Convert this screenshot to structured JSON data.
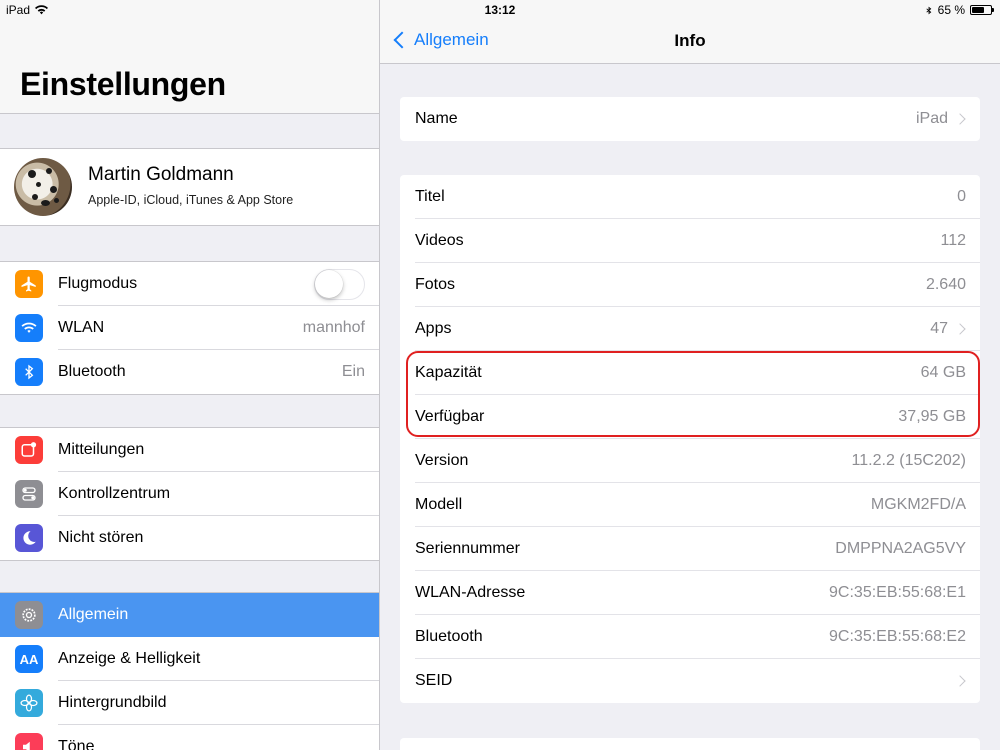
{
  "statusbar": {
    "device": "iPad",
    "time": "13:12",
    "battery": "65 %",
    "battery_level": 0.65
  },
  "left": {
    "title": "Einstellungen",
    "profile": {
      "name": "Martin Goldmann",
      "subtitle": "Apple-ID, iCloud, iTunes & App Store"
    },
    "group1": [
      {
        "label": "Flugmodus",
        "icon": "airplane-icon",
        "color": "#ff9500",
        "toggle": false
      },
      {
        "label": "WLAN",
        "value": "mannhof",
        "icon": "wifi-icon",
        "color": "#157efb"
      },
      {
        "label": "Bluetooth",
        "value": "Ein",
        "icon": "bluetooth-icon",
        "color": "#157efb"
      }
    ],
    "group2": [
      {
        "label": "Mitteilungen",
        "icon": "notifications-icon",
        "color": "#fc3d39"
      },
      {
        "label": "Kontrollzentrum",
        "icon": "control-center-icon",
        "color": "#8e8e93"
      },
      {
        "label": "Nicht stören",
        "icon": "moon-icon",
        "color": "#5856d6"
      }
    ],
    "group3": [
      {
        "label": "Allgemein",
        "icon": "gear-icon",
        "color": "#8e8e93",
        "selected": true
      },
      {
        "label": "Anzeige & Helligkeit",
        "icon": "display-icon",
        "color": "#157efb",
        "glyph": "AA"
      },
      {
        "label": "Hintergrundbild",
        "icon": "wallpaper-icon",
        "color": "#34aadc"
      },
      {
        "label": "Töne",
        "icon": "sounds-icon",
        "color": "#fc3d58"
      }
    ]
  },
  "right": {
    "back_label": "Allgemein",
    "title": "Info",
    "name_row": {
      "label": "Name",
      "value": "iPad"
    },
    "rows": [
      {
        "label": "Titel",
        "value": "0"
      },
      {
        "label": "Videos",
        "value": "112"
      },
      {
        "label": "Fotos",
        "value": "2.640"
      },
      {
        "label": "Apps",
        "value": "47",
        "chevron": true
      },
      {
        "label": "Kapazität",
        "value": "64 GB"
      },
      {
        "label": "Verfügbar",
        "value": "37,95 GB"
      },
      {
        "label": "Version",
        "value": "11.2.2 (15C202)"
      },
      {
        "label": "Modell",
        "value": "MGKM2FD/A"
      },
      {
        "label": "Seriennummer",
        "value": "DMPPNA2AG5VY"
      },
      {
        "label": "WLAN-Adresse",
        "value": "9C:35:EB:55:68:E1"
      },
      {
        "label": "Bluetooth",
        "value": "9C:35:EB:55:68:E2"
      },
      {
        "label": "SEID",
        "value": "",
        "chevron": true
      }
    ]
  }
}
